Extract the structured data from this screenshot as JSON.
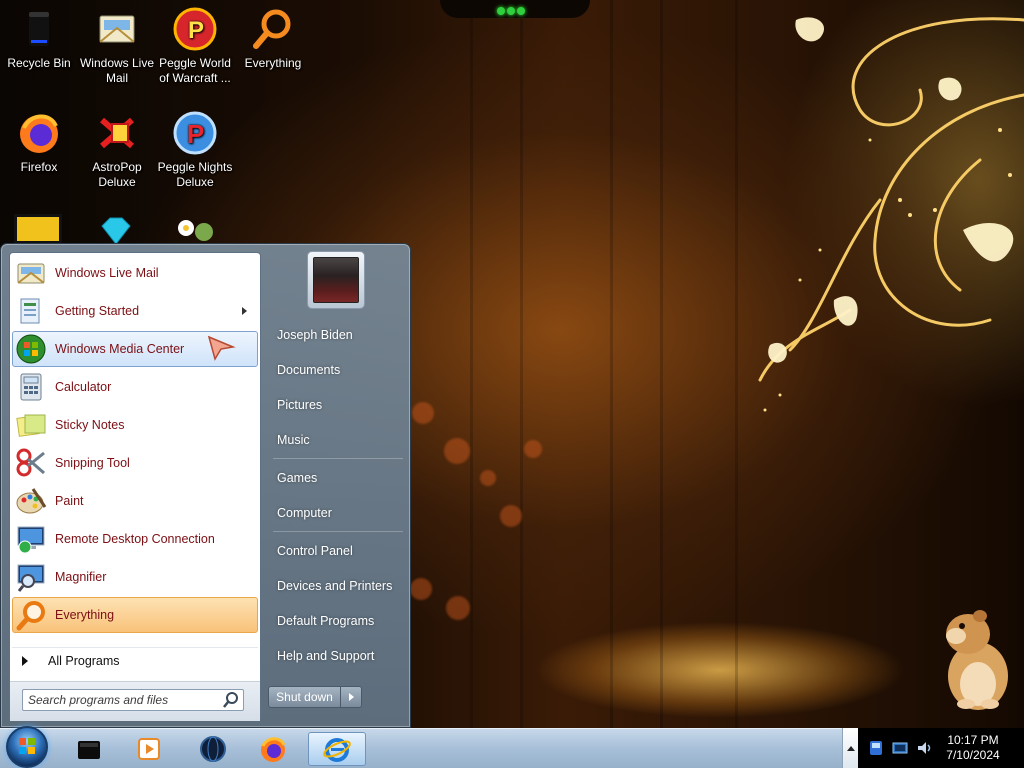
{
  "desktop": {
    "icons": [
      {
        "label": "Recycle Bin",
        "icon": "recycle-bin-icon"
      },
      {
        "label": "Windows Live Mail",
        "icon": "mail-icon"
      },
      {
        "label": "Peggle World of Warcraft ...",
        "icon": "peggle-icon"
      },
      {
        "label": "Everything",
        "icon": "magnifier-icon"
      },
      {
        "label": "Firefox",
        "icon": "firefox-icon"
      },
      {
        "label": "AstroPop Deluxe",
        "icon": "astropop-icon"
      },
      {
        "label": "Peggle Nights Deluxe",
        "icon": "peggle-nights-icon"
      }
    ]
  },
  "start_menu": {
    "programs": [
      {
        "label": "Windows Live Mail",
        "icon": "mail-icon"
      },
      {
        "label": "Getting Started",
        "icon": "getting-started-icon",
        "has_submenu": true
      },
      {
        "label": "Windows Media Center",
        "icon": "windows-media-center-icon",
        "state": "hover"
      },
      {
        "label": "Calculator",
        "icon": "calculator-icon"
      },
      {
        "label": "Sticky Notes",
        "icon": "sticky-notes-icon"
      },
      {
        "label": "Snipping Tool",
        "icon": "scissors-icon"
      },
      {
        "label": "Paint",
        "icon": "paint-palette-icon"
      },
      {
        "label": "Remote Desktop Connection",
        "icon": "remote-desktop-icon"
      },
      {
        "label": "Magnifier",
        "icon": "magnifier-icon"
      },
      {
        "label": "Everything",
        "icon": "search-icon",
        "state": "selected"
      }
    ],
    "all_programs": "All Programs",
    "search_placeholder": "Search programs and files",
    "places": [
      "Joseph Biden",
      "Documents",
      "Pictures",
      "Music",
      "Games",
      "Computer",
      "Control Panel",
      "Devices and Printers",
      "Default Programs",
      "Help and Support"
    ],
    "shutdown_label": "Shut down"
  },
  "taskbar": {
    "pinned": [
      {
        "name": "black-app-icon"
      },
      {
        "name": "media-player-icon"
      },
      {
        "name": "globe-app-icon"
      },
      {
        "name": "firefox-icon"
      },
      {
        "name": "internet-explorer-icon",
        "active": true
      }
    ]
  },
  "clock": {
    "time": "10:17 PM",
    "date": "7/10/2024"
  },
  "colors": {
    "program_label": "#7b0f14",
    "selected_highlight": "#f9c27a",
    "hover_highlight": "#cfe3fa"
  }
}
